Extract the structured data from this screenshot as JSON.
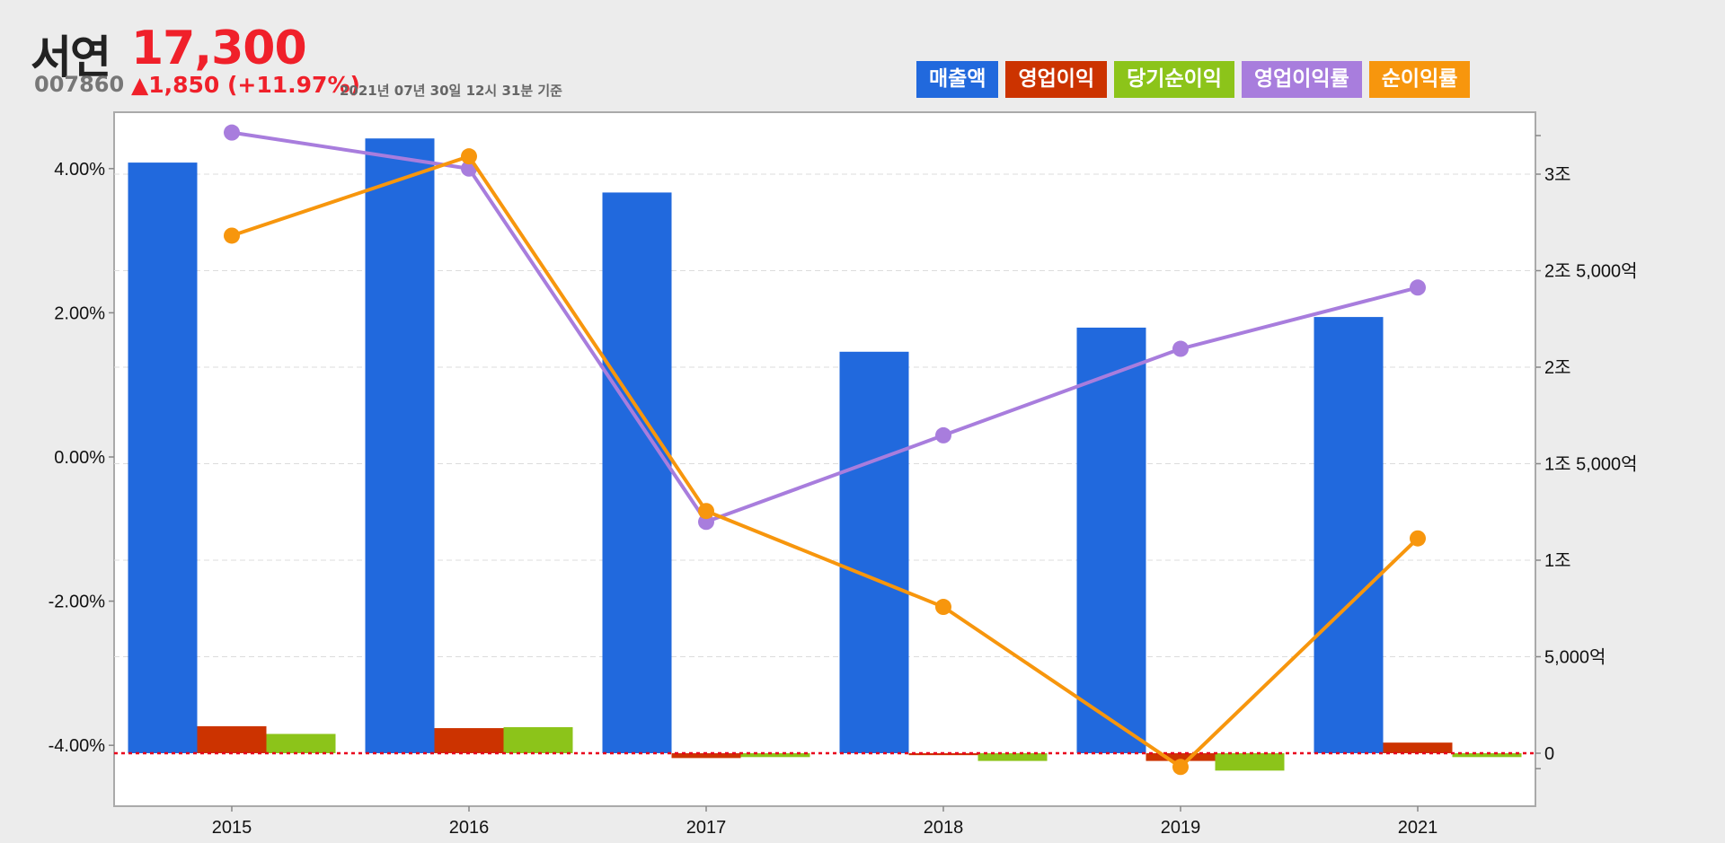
{
  "stock": {
    "name": "서연",
    "price": "17,300",
    "code": "007860",
    "change": "▲1,850 (+11.97%)",
    "as_of": "2021년 07년 30일 12시 31분 기준"
  },
  "colors": {
    "revenue": "#2169dd",
    "operating_profit": "#cc3300",
    "net_income": "#8cc41a",
    "op_margin": "#a87ddd",
    "net_margin": "#f7960d",
    "zero_line": "#e8001c"
  },
  "chart_data": {
    "type": "bar",
    "categories": [
      "2015",
      "2016",
      "2017",
      "2018",
      "2019",
      "2021"
    ],
    "legend_position": "top-right",
    "grid": true,
    "left_axis": {
      "ticks": [
        "4.00%",
        "2.00%",
        "0.00%",
        "-2.00%",
        "-4.00%"
      ],
      "tick_values": [
        4,
        2,
        0,
        -2,
        -4
      ]
    },
    "right_axis": {
      "ticks": [
        "3조",
        "2조 5,000억",
        "2조",
        "1조 5,000억",
        "1조",
        "5,000억",
        "0"
      ],
      "tick_values": [
        30000,
        25000,
        20000,
        15000,
        10000,
        5000,
        0
      ]
    },
    "series": [
      {
        "name": "매출액",
        "type": "bar",
        "axis": "right",
        "color_key": "revenue",
        "values": [
          30600,
          31850,
          29050,
          20800,
          22050,
          22600
        ]
      },
      {
        "name": "영업이익",
        "type": "bar",
        "axis": "right",
        "color_key": "operating_profit",
        "values": [
          1400,
          1300,
          -250,
          -100,
          -400,
          550
        ]
      },
      {
        "name": "당기순이익",
        "type": "bar",
        "axis": "right",
        "color_key": "net_income",
        "values": [
          1000,
          1350,
          -200,
          -400,
          -900,
          -200
        ]
      },
      {
        "name": "영업이익률",
        "type": "line",
        "axis": "left",
        "color_key": "op_margin",
        "values": [
          4.5,
          4.0,
          -0.9,
          0.3,
          1.5,
          2.35
        ]
      },
      {
        "name": "순이익률",
        "type": "line",
        "axis": "left",
        "color_key": "net_margin",
        "values": [
          3.07,
          4.17,
          -0.75,
          -2.08,
          -4.3,
          -1.13
        ]
      }
    ]
  }
}
